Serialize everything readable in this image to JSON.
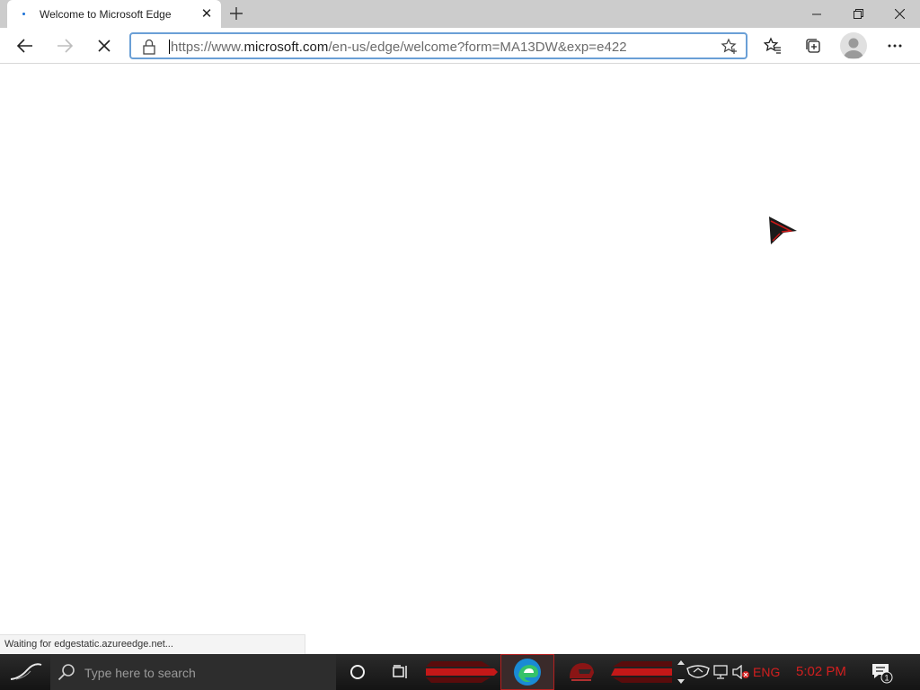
{
  "tab": {
    "title": "Welcome to Microsoft Edge"
  },
  "address_bar": {
    "url_prefix": "https://www.",
    "url_host": "microsoft.com",
    "url_path": "/en-us/edge/welcome?form=MA13DW&exp=e422"
  },
  "status_bar": {
    "text": "Waiting for edgestatic.azureedge.net..."
  },
  "taskbar": {
    "search_placeholder": "Type here to search",
    "language": "ENG",
    "time": "5:02 PM",
    "notification_count": "1"
  },
  "colors": {
    "accent_red": "#d21f1f",
    "address_focus": "#6a9fd6",
    "tabstrip_bg": "#cccccc",
    "taskbar_bg": "#1a1a1a"
  },
  "icons": {
    "tab": [
      "loading-icon",
      "close-icon",
      "plus-icon"
    ],
    "window": [
      "minimize-icon",
      "restore-icon",
      "close-icon"
    ],
    "toolbar": [
      "back-arrow-icon",
      "forward-arrow-icon",
      "stop-icon",
      "lock-icon",
      "star-add-icon",
      "favorites-icon",
      "collections-icon",
      "profile-icon",
      "more-icon"
    ],
    "taskbar": [
      "start-icon",
      "search-icon",
      "cortana-icon",
      "task-view-icon",
      "edge-icon",
      "helmet-app-icon",
      "shield-icon",
      "network-icon",
      "volume-muted-icon",
      "notification-icon"
    ]
  }
}
